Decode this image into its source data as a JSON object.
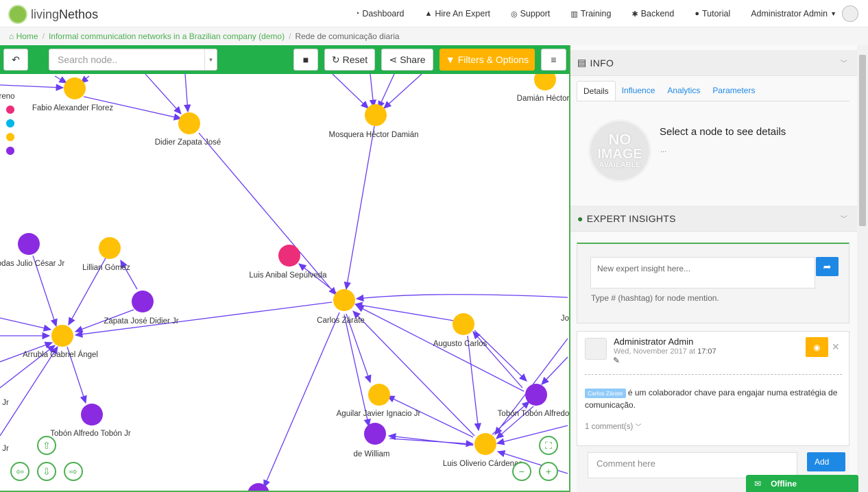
{
  "app": {
    "logo_text_a": "living",
    "logo_text_b": "Nethos"
  },
  "nav": {
    "items": [
      {
        "icon": "dashboard-icon",
        "glyph": "🎨",
        "label": "Dashboard"
      },
      {
        "icon": "graduation-cap-icon",
        "glyph": "🎓",
        "label": "Hire An Expert"
      },
      {
        "icon": "lifebuoy-icon",
        "glyph": "⛑",
        "label": "Support"
      },
      {
        "icon": "bank-icon",
        "glyph": "🏛",
        "label": "Training"
      },
      {
        "icon": "gear-icon",
        "glyph": "⚙",
        "label": "Backend"
      },
      {
        "icon": "question-icon",
        "glyph": "❓",
        "label": "Tutorial"
      }
    ],
    "user": "Administrator Admin"
  },
  "breadcrumb": {
    "home": "Home",
    "project": "Informal communication networks in a Brazilian company (demo)",
    "current": "Rede de comunicação diaria"
  },
  "toolbar": {
    "back_glyph": "↶",
    "search_placeholder": "Search node..",
    "stop_glyph": "■",
    "reset": "Reset",
    "share": "Share",
    "filters": "Filters & Options",
    "menu_glyph": "≡"
  },
  "colors": {
    "accent": "#22b04b",
    "orange": "#ffb300",
    "purple": "#8a2be2",
    "pink": "#ec2d7a",
    "cyan": "#00b7ec",
    "yellow_node": "#ffc107",
    "edge": "#6a3df0"
  },
  "graph": {
    "legend_colors": [
      "#ec2d7a",
      "#00b7ec",
      "#ffc107",
      "#8a2be2"
    ],
    "nodes": [
      {
        "label": "Fabio Alexander Florez"
      },
      {
        "label": "Didier Zapata José"
      },
      {
        "label": "Mosquera Héctor Damián"
      },
      {
        "label": "Damián Héctor"
      },
      {
        "label": "Luis Anibal Sepúlveda"
      },
      {
        "label": "Carlos Zárate"
      },
      {
        "label": "Lillian Gómez"
      },
      {
        "label": "Zapata José Didier Jr"
      },
      {
        "label": "Arrubla Gabriel Ángel"
      },
      {
        "label": "odas Julio César Jr"
      },
      {
        "label": "Tobón Alfredo Tobón Jr"
      },
      {
        "label": "Augusto Carlos"
      },
      {
        "label": "Aguilar Javier Ignacio Jr"
      },
      {
        "label": "de William"
      },
      {
        "label": "Luis Oliverio Cárdenas"
      },
      {
        "label": "Tobón Tobón Alfredo"
      },
      {
        "label": "reno"
      },
      {
        "label": "Jr"
      },
      {
        "label": "Jr"
      },
      {
        "label": "Jo"
      }
    ]
  },
  "info": {
    "title": "INFO",
    "tabs": [
      "Details",
      "Influence",
      "Analytics",
      "Parameters"
    ],
    "noimg_top": "NO",
    "noimg_mid": "IMAGE",
    "noimg_bot": "AVAILABLE",
    "select_title": "Select a node to see details",
    "select_sub": "..."
  },
  "insights": {
    "title": "EXPERT INSIGHTS",
    "placeholder": "New expert insight here...",
    "hint": "Type # (hashtag) for node mention.",
    "post": {
      "author": "Administrator Admin",
      "date_prefix": "Wed, November 2017 at",
      "time": "17:07",
      "tag": "Carlos Zárate",
      "text": "é um colaborador chave para engajar numa estratégia de comunicação.",
      "comments": "1 comment(s)"
    },
    "comment_placeholder": "Comment here",
    "add": "Add"
  },
  "status": {
    "label": "Offline"
  }
}
